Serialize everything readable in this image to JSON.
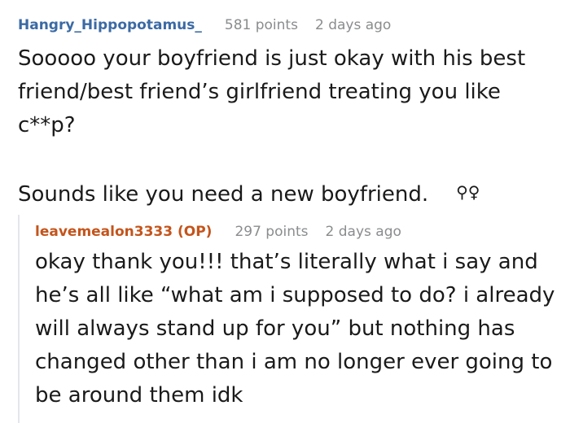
{
  "comments": [
    {
      "author": "Hangry_Hippopotamus_",
      "author_color": "#3b6aa4",
      "points": "581 points",
      "time": "2 days ago",
      "paragraphs": [
        "Sooooo your boyfriend is just okay with his best friend/best friend’s girlfriend treating you like c**p?",
        "Sounds like you need a new boyfriend."
      ],
      "icon": "female-sign-icon",
      "icon_glyph": "⚲♀"
    },
    {
      "author": "leavemealon3333 (OP)",
      "author_color": "#c4541b",
      "points": "297 points",
      "time": "2 days ago",
      "paragraphs": [
        "okay thank you!!! that’s literally what i say and he’s all like “what am i supposed to do? i already will always stand up for you” but nothing has changed other than i am no longer ever going to be around them idk"
      ]
    }
  ]
}
